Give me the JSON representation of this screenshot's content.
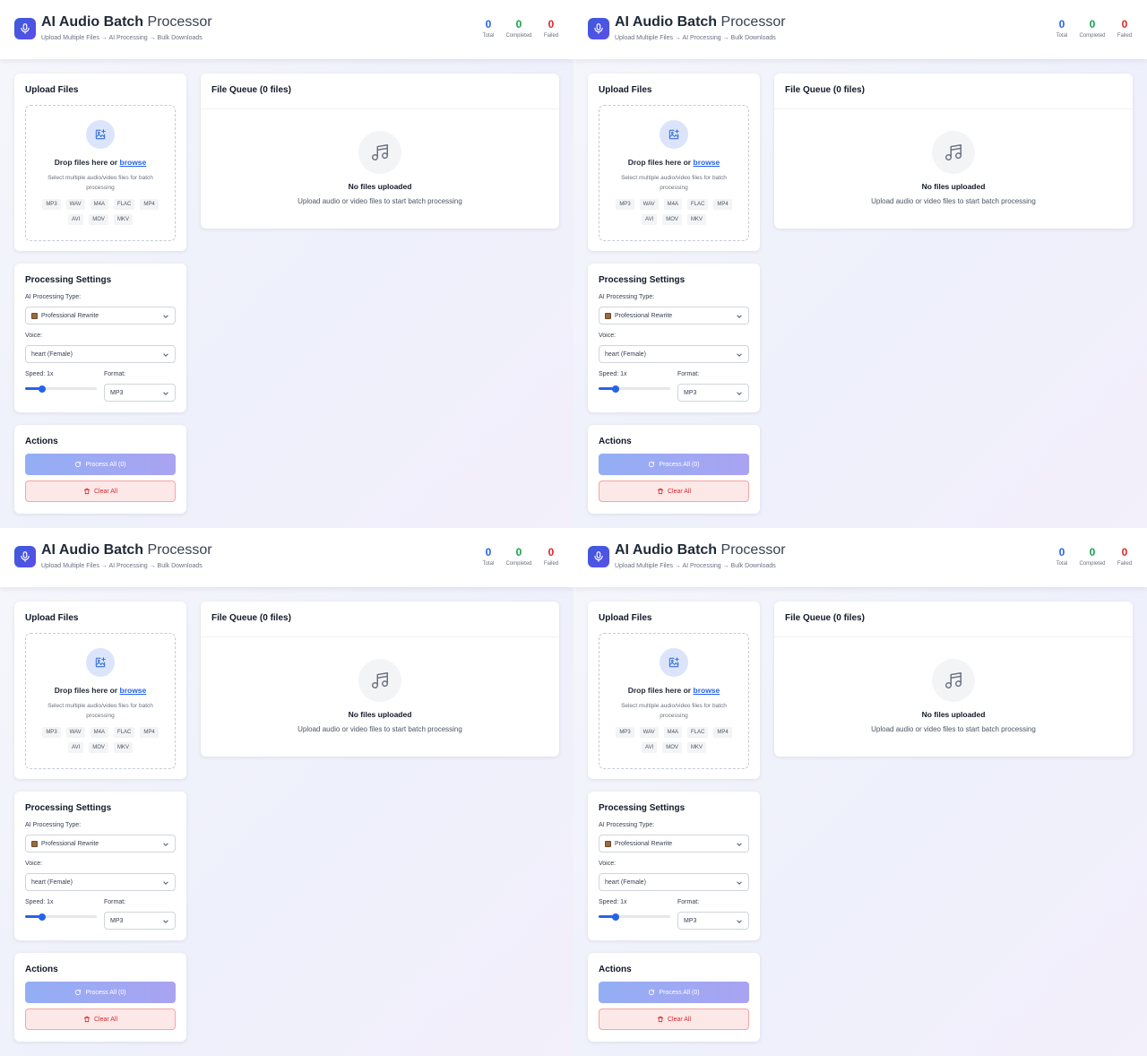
{
  "header": {
    "title_main": "AI Audio Batch",
    "title_rest": "Processor",
    "subtitle": "Upload Multiple Files → AI Processing → Bulk Downloads"
  },
  "stats": {
    "total": {
      "value": "0",
      "label": "Total",
      "color": "#2563eb"
    },
    "completed": {
      "value": "0",
      "label": "Completed",
      "color": "#16a34a"
    },
    "failed": {
      "value": "0",
      "label": "Failed",
      "color": "#dc2626"
    }
  },
  "upload": {
    "title": "Upload Files",
    "drop_text": "Drop files here or",
    "browse": "browse",
    "hint": "Select multiple audio/video files for batch processing",
    "formats": [
      "MP3",
      "WAV",
      "M4A",
      "FLAC",
      "MP4",
      "AVI",
      "MOV",
      "MKV"
    ]
  },
  "settings": {
    "title": "Processing Settings",
    "type_label": "AI Processing Type:",
    "type_value": "Professional Rewrite",
    "voice_label": "Voice:",
    "voice_value": "heart (Female)",
    "speed_label": "Speed: 1x",
    "speed_fraction": 0.24,
    "format_label": "Format:",
    "format_value": "MP3"
  },
  "actions": {
    "title": "Actions",
    "process_label": "Process All (0)",
    "clear_label": "Clear All"
  },
  "queue": {
    "title": "File Queue (0 files)",
    "empty_title": "No files uploaded",
    "empty_sub": "Upload audio or video files to start batch processing"
  },
  "icons": {
    "logo": "microphone-icon",
    "upload": "image-upload-icon",
    "empty": "music-note-icon",
    "process": "refresh-icon",
    "clear": "trash-icon",
    "chevron": "chevron-down-icon"
  }
}
